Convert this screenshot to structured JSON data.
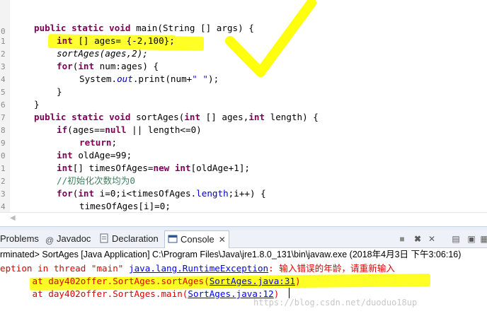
{
  "editor": {
    "line_numbers": [
      "0",
      "1",
      "2",
      "3",
      "4",
      "5",
      "6",
      "7",
      "8",
      "9",
      "0",
      "1",
      "2",
      "3",
      "4"
    ],
    "lines": {
      "l0": {
        "kw1": "public static void ",
        "rest": "main(String [] args) {"
      },
      "l1": {
        "kw1": "int",
        "rest": " [] ages= {-2,100};"
      },
      "l2": {
        "rest": "sortAges(ages,2);"
      },
      "l3": {
        "kw1": "for",
        "p1": "(",
        "kw2": "int",
        "rest": " num:ages) {"
      },
      "l4": {
        "p1": "System.",
        "fld": "out",
        "p2": ".print(num+",
        "str": "\" \"",
        "p3": ");"
      },
      "l5": {
        "rest": "}"
      },
      "l6": {
        "rest": "}"
      },
      "l7": {
        "kw1": "public static void ",
        "p1": "sortAges(",
        "kw2": "int",
        "p2": " [] ages,",
        "kw3": "int",
        "p3": " length) {"
      },
      "l8": {
        "kw1": "if",
        "p1": "(ages==",
        "kw2": "null",
        "p2": " || length<=0)"
      },
      "l9": {
        "kw1": "return",
        "rest": ";"
      },
      "l10": {
        "kw1": "int",
        "rest": " oldAge=99;"
      },
      "l11": {
        "kw1": "int",
        "p1": "[] timesOfAges=",
        "kw2": "new",
        "p2": " ",
        "kw3": "int",
        "p3": "[oldAge+1];"
      },
      "l12": {
        "cmt": "//初始化次数均为0"
      },
      "l13": {
        "kw1": "for",
        "p1": "(",
        "kw2": "int",
        "p2": " i=0;i<timesOfAges.",
        "fld": "length",
        "p3": ";i++) {"
      },
      "l14": {
        "rest": "timesOfAges[i]=0;"
      }
    }
  },
  "tabs": {
    "problems": "Problems",
    "javadoc": "Javadoc",
    "declaration": "Declaration",
    "console": "Console"
  },
  "status": "rminated> SortAges [Java Application] C:\\Program Files\\Java\\jre1.8.0_131\\bin\\javaw.exe (2018年4月3日 下午3:06:16)",
  "console": {
    "line1_a": "eption in thread \"main\" ",
    "line1_link": "java.lang.RuntimeException",
    "line1_b": ": 输入错误的年龄，请重新输入",
    "line2_a": "      at day402offer.SortAges.sortAges(",
    "line2_link": "SortAges.java:31",
    "line2_b": ")",
    "line3_a": "      at day402offer.SortAges.main(",
    "line3_link": "SortAges.java:12",
    "line3_b": ")"
  },
  "watermark": "https://blog.csdn.net/duoduo18up",
  "colors": {
    "highlight": "#ffff00",
    "keyword": "#7f0055",
    "error": "#e00000",
    "link": "#0000ff",
    "comment": "#3f7f5f"
  }
}
